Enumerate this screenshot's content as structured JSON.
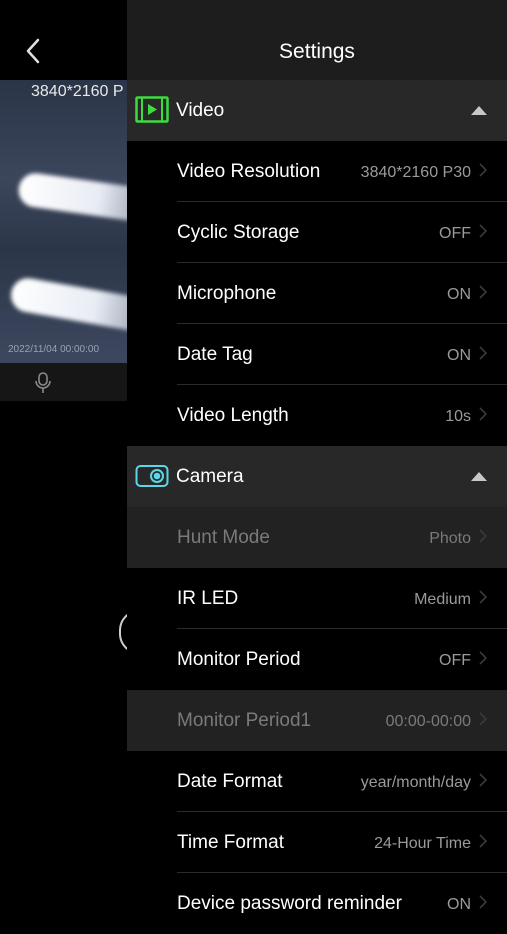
{
  "header": {
    "title": "Settings"
  },
  "preview": {
    "resolution": "3840*2160 P",
    "timestamp": "2022/11/04 00:00:00"
  },
  "sections": {
    "video": {
      "label": "Video",
      "icon": "video-icon",
      "color": "#3ddc3d"
    },
    "camera": {
      "label": "Camera",
      "icon": "camera-icon",
      "color": "#5ad7e8"
    }
  },
  "rows": [
    {
      "label": "Video Resolution",
      "value": "3840*2160 P30"
    },
    {
      "label": "Cyclic Storage",
      "value": "OFF"
    },
    {
      "label": "Microphone",
      "value": "ON"
    },
    {
      "label": "Date Tag",
      "value": "ON"
    },
    {
      "label": "Video Length",
      "value": "10s"
    },
    {
      "label": "Hunt Mode",
      "value": "Photo"
    },
    {
      "label": "IR LED",
      "value": "Medium"
    },
    {
      "label": "Monitor Period",
      "value": "OFF"
    },
    {
      "label": "Monitor Period1",
      "value": "00:00-00:00"
    },
    {
      "label": "Date Format",
      "value": "year/month/day"
    },
    {
      "label": "Time Format",
      "value": "24-Hour Time"
    },
    {
      "label": "Device password reminder",
      "value": "ON"
    }
  ]
}
